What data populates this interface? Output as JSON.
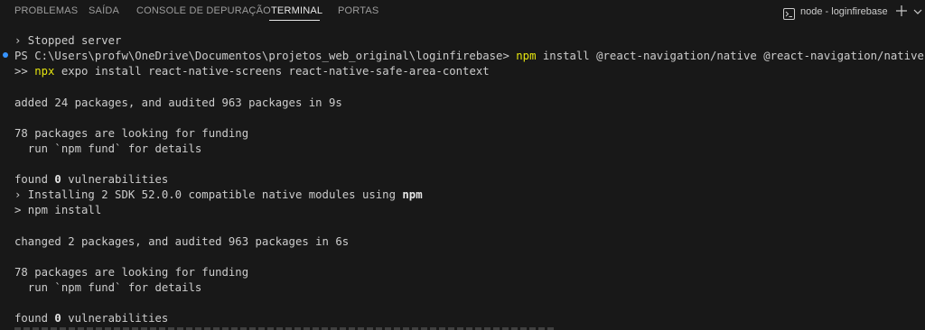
{
  "tabs": [
    {
      "label": "PROBLEMAS"
    },
    {
      "label": "SAÍDA"
    },
    {
      "label": "CONSOLE DE DEPURAÇÃO"
    },
    {
      "label": "TERMINAL"
    },
    {
      "label": "PORTAS"
    }
  ],
  "active_tab": "TERMINAL",
  "terminal_instance": {
    "label": "node - loginfirebase",
    "icon": "terminal-icon"
  },
  "actions": {
    "add_icon": "plus-icon",
    "dropdown_icon": "chevron-down-icon"
  },
  "colors": {
    "background": "#181818",
    "text": "#cccccc",
    "highlight": "#e5e510",
    "prompt_marker": "#3794ff"
  },
  "lines": {
    "l1": "› Stopped server",
    "l2_prefix": "PS C:\\Users\\profw\\OneDrive\\Documentos\\projetos_web_original\\loginfirebase> ",
    "l2_cmd": "npm",
    "l2_rest": " install @react-navigation/native @react-navigation/native-stack",
    "l3_prefix": ">> ",
    "l3_cmd": "npx",
    "l3_rest": " expo install react-native-screens react-native-safe-area-context",
    "l4": "added 24 packages, and audited 963 packages in 9s",
    "l5": "78 packages are looking for funding",
    "l6": "  run `npm fund` for details",
    "l7_a": "found ",
    "l7_num": "0",
    "l7_b": " vulnerabilities",
    "l8_a": "› Installing 2 SDK 52.0.0 compatible native modules using ",
    "l8_bold": "npm",
    "l9": "> npm install",
    "l10": "changed 2 packages, and audited 963 packages in 6s",
    "l11": "78 packages are looking for funding",
    "l12": "  run `npm fund` for details",
    "l13_a": "found ",
    "l13_num": "0",
    "l13_b": " vulnerabilities"
  }
}
